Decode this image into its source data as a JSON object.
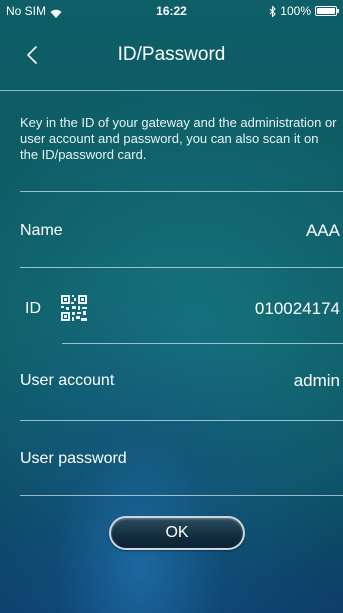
{
  "status_bar": {
    "carrier": "No SIM",
    "time": "16:22",
    "battery": "100%",
    "battery_level": 1.0
  },
  "nav": {
    "title": "ID/Password",
    "back_icon": "chevron-left-icon"
  },
  "intro": {
    "text": "Key in the ID of your gateway and the administration or user account and password, you can also scan it on the ID/password card."
  },
  "form": {
    "name": {
      "label": "Name",
      "value": "AAA"
    },
    "id": {
      "label": "ID",
      "value": "010024174",
      "icon": "qr-code-icon"
    },
    "user_account": {
      "label": "User account",
      "value": "admin"
    },
    "user_password": {
      "label": "User password",
      "value": ""
    }
  },
  "actions": {
    "ok_label": "OK"
  },
  "colors": {
    "background_top": "#0e5f68",
    "background_bottom": "#0d3f6a",
    "text": "#ffffff",
    "divider": "#ffffff",
    "button_fill": "#142f40",
    "button_border": "#c9d6dc"
  }
}
